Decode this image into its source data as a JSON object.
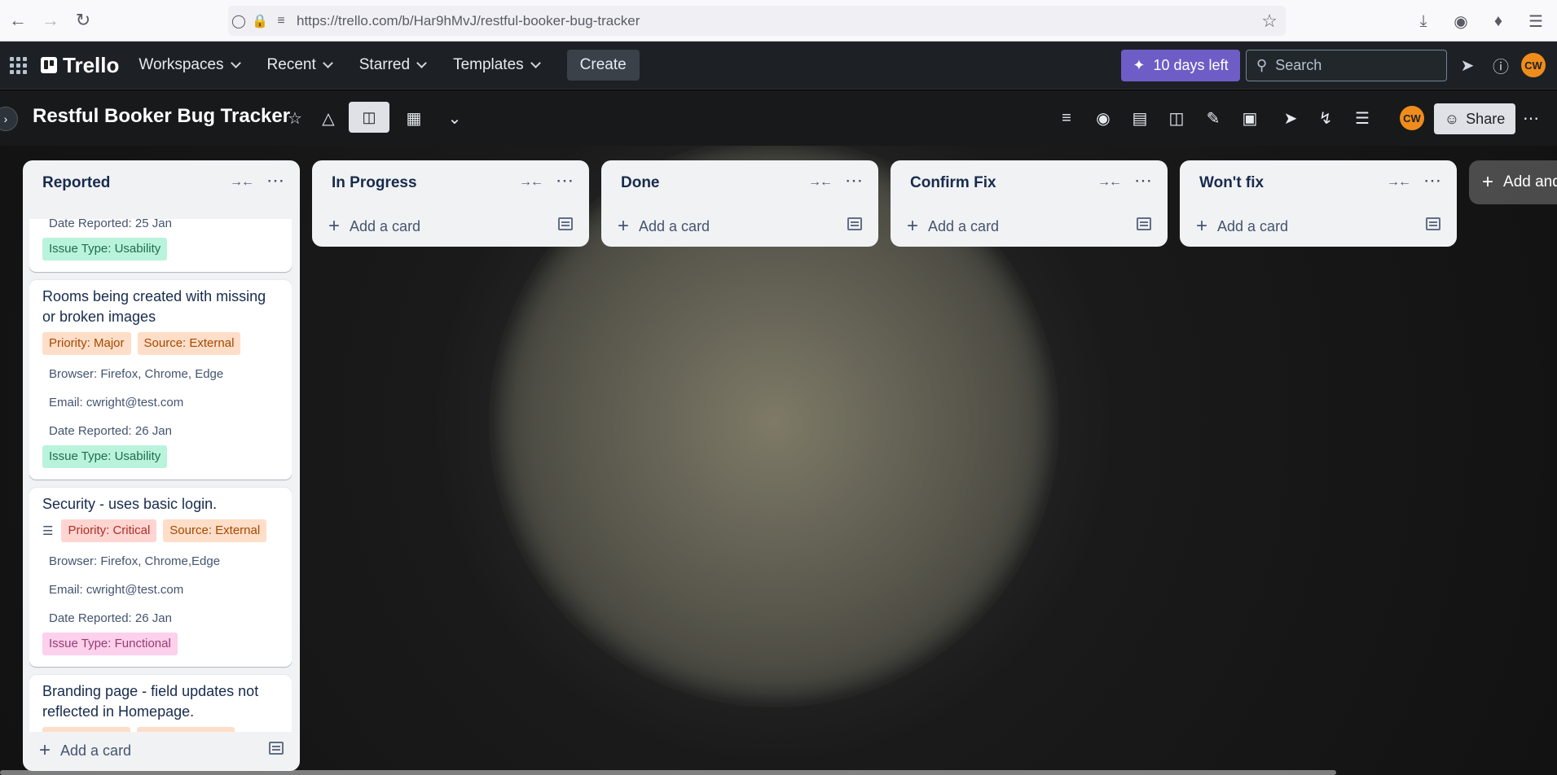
{
  "browser": {
    "url": "https://trello.com/b/Har9hMvJ/restful-booker-bug-tracker"
  },
  "header": {
    "logo_text": "Trello",
    "menu": [
      "Workspaces",
      "Recent",
      "Starred",
      "Templates"
    ],
    "create_label": "Create",
    "trial_label": "10 days left",
    "search_placeholder": "Search",
    "avatar_initials": "CW"
  },
  "board": {
    "title": "Restful Booker Bug Tracker",
    "share_label": "Share",
    "avatar_initials": "CW",
    "lists": [
      {
        "title": "Reported",
        "add_card": "Add a card"
      },
      {
        "title": "In Progress",
        "add_card": "Add a card"
      },
      {
        "title": "Done",
        "add_card": "Add a card"
      },
      {
        "title": "Confirm Fix",
        "add_card": "Add a card"
      },
      {
        "title": "Won't fix",
        "add_card": "Add a card"
      }
    ],
    "add_another": "Add and",
    "cards": [
      {
        "date": "Date Reported: 25 Jan",
        "issue_type": "Issue Type: Usability"
      },
      {
        "title": "Rooms being created with missing or broken images",
        "priority": "Priority: Major",
        "source": "Source: External",
        "browser": "Browser: Firefox, Chrome, Edge",
        "email": "Email: cwright@test.com",
        "date": "Date Reported: 26 Jan",
        "issue_type": "Issue Type: Usability"
      },
      {
        "title": "Security - uses basic login.",
        "priority": "Priority: Critical",
        "source": "Source: External",
        "browser": "Browser: Firefox, Chrome,Edge",
        "email": "Email: cwright@test.com",
        "date": "Date Reported: 26 Jan",
        "issue_type": "Issue Type: Functional"
      },
      {
        "title": "Branding page - field updates not reflected in Homepage."
      }
    ]
  },
  "colors": {
    "header_bg": "#1d2125",
    "list_bg": "#f1f2f4",
    "trial_purple": "#6e5dc6",
    "avatar_orange": "#f08c1c"
  }
}
